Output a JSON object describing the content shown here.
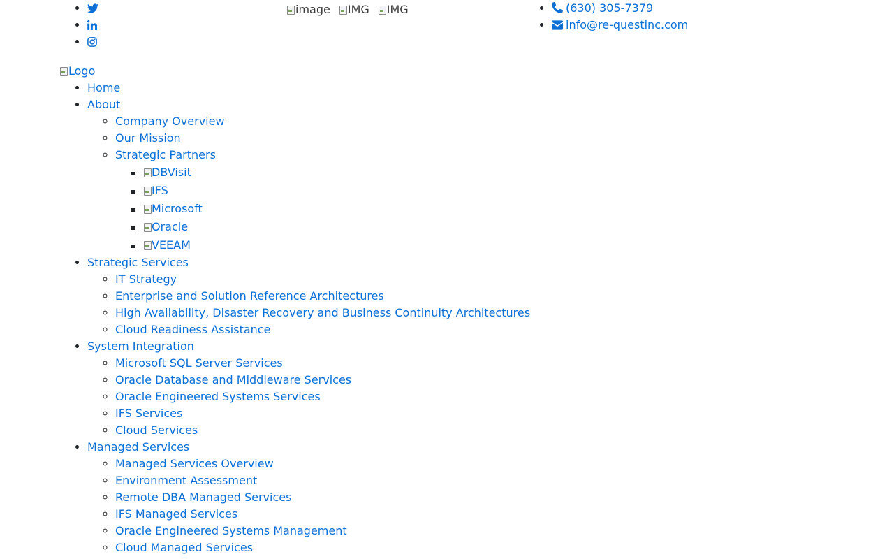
{
  "social": [
    {
      "id": "twitter",
      "icon": "twitter-icon"
    },
    {
      "id": "linkedin",
      "icon": "linkedin-icon"
    },
    {
      "id": "instagram",
      "icon": "instagram-icon"
    }
  ],
  "header_images": [
    "image",
    "IMG",
    "IMG"
  ],
  "contact": {
    "phone": "(630) 305-7379",
    "email": "info@re-questinc.com"
  },
  "logo_alt": "Logo",
  "nav": {
    "home": "Home",
    "about": {
      "label": "About",
      "items": [
        "Company Overview",
        "Our Mission",
        "Strategic Partners"
      ],
      "partners": [
        "DBVisit",
        "IFS",
        "Microsoft",
        "Oracle",
        "VEEAM"
      ]
    },
    "strategic": {
      "label": "Strategic Services",
      "items": [
        "IT Strategy",
        "Enterprise and Solution Reference Architectures",
        "High Availability, Disaster Recovery and Business Continuity Architectures",
        "Cloud Readiness Assistance"
      ]
    },
    "integration": {
      "label": "System Integration",
      "items": [
        "Microsoft SQL Server Services",
        "Oracle Database and Middleware Services",
        "Oracle Engineered Systems Services",
        "IFS Services",
        "Cloud Services"
      ]
    },
    "managed": {
      "label": "Managed Services",
      "items": [
        "Managed Services Overview",
        "Environment Assessment",
        "Remote DBA Managed Services",
        "IFS Managed Services",
        "Oracle Engineered Systems Management",
        "Cloud Managed Services"
      ]
    }
  },
  "colors": {
    "link": "#0a6fd6",
    "text": "#212529",
    "background": "#ffffff"
  }
}
